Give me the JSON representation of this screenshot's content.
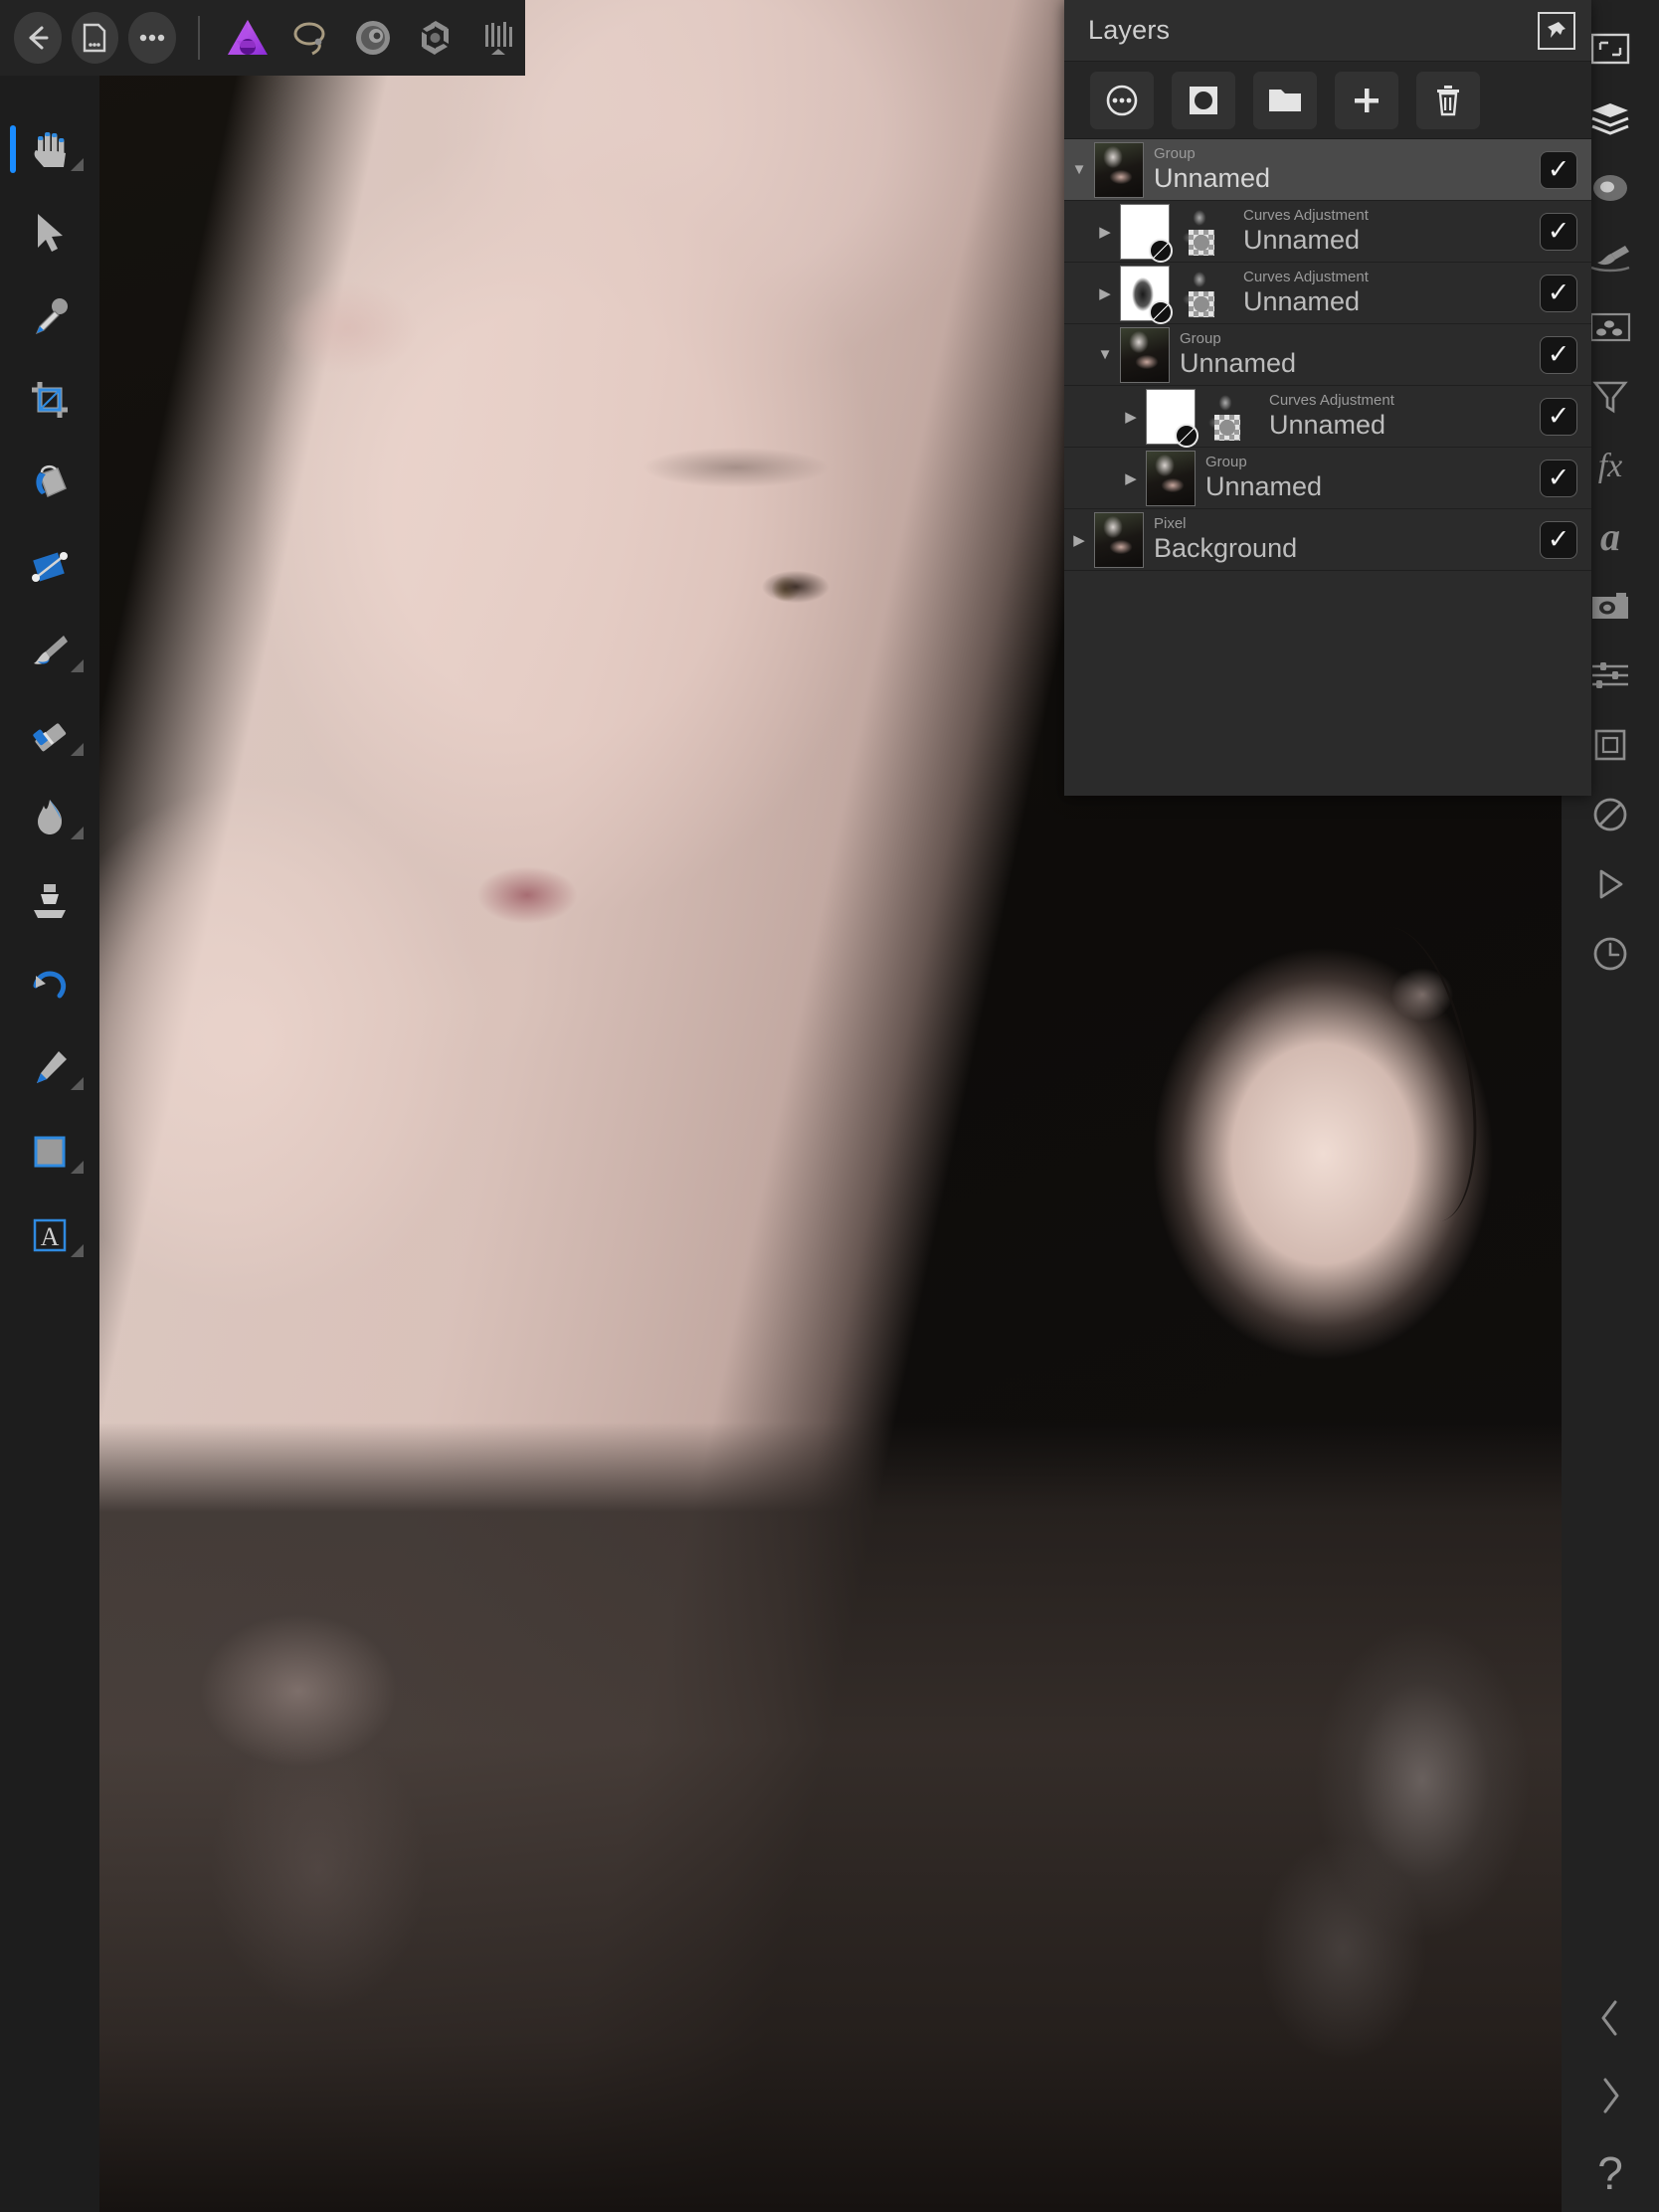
{
  "app": {
    "name": "Affinity Photo",
    "accent": "#1a8cff",
    "brand_purple": "#b44ae0",
    "panel_bg": "#2b2b2b"
  },
  "top_toolbar": {
    "buttons": [
      {
        "name": "back",
        "icon": "back-arrow-icon",
        "label": "←"
      },
      {
        "name": "document",
        "icon": "document-icon",
        "label": "☰"
      },
      {
        "name": "more",
        "icon": "more-ellipsis-icon",
        "label": "•••"
      }
    ],
    "personas": [
      {
        "name": "photo-persona",
        "icon": "affinity-photo-logo-icon"
      },
      {
        "name": "liquify-persona",
        "icon": "liquify-lasso-icon"
      },
      {
        "name": "develop-persona",
        "icon": "develop-spiral-icon"
      },
      {
        "name": "export-persona",
        "icon": "aperture-icon"
      },
      {
        "name": "tone-mapping-persona",
        "icon": "tone-bars-icon"
      }
    ]
  },
  "tools": [
    {
      "name": "hand-tool",
      "icon": "hand-icon",
      "glyph": "✋",
      "active": true,
      "has_flyout": true
    },
    {
      "name": "move-tool",
      "icon": "cursor-arrow-icon",
      "glyph": "➤",
      "active": false,
      "has_flyout": false
    },
    {
      "name": "color-picker-tool",
      "icon": "eyedropper-icon",
      "glyph": "✒",
      "active": false,
      "has_flyout": false
    },
    {
      "name": "crop-tool",
      "icon": "crop-icon",
      "glyph": "⌗",
      "active": false,
      "has_flyout": false
    },
    {
      "name": "paint-bucket-tool",
      "icon": "paint-bucket-icon",
      "glyph": "⛃",
      "active": false,
      "has_flyout": false
    },
    {
      "name": "gradient-tool",
      "icon": "gradient-icon",
      "glyph": "◆",
      "active": false,
      "has_flyout": false
    },
    {
      "name": "paint-brush-tool",
      "icon": "paint-brush-icon",
      "glyph": "✒",
      "active": false,
      "has_flyout": true
    },
    {
      "name": "erase-brush-tool",
      "icon": "eraser-icon",
      "glyph": "✎",
      "active": false,
      "has_flyout": true
    },
    {
      "name": "smudge-brush-tool",
      "icon": "flame-smudge-icon",
      "glyph": "ὒ5",
      "active": false,
      "has_flyout": true
    },
    {
      "name": "clone-brush-tool",
      "icon": "clone-stamp-icon",
      "glyph": "⚒",
      "active": false,
      "has_flyout": false
    },
    {
      "name": "undo-brush-tool",
      "icon": "undo-brush-icon",
      "glyph": "↩",
      "active": false,
      "has_flyout": false
    },
    {
      "name": "pen-tool",
      "icon": "pen-nib-icon",
      "glyph": "✑",
      "active": false,
      "has_flyout": true
    },
    {
      "name": "shape-tool",
      "icon": "rectangle-shape-icon",
      "glyph": "▣",
      "active": false,
      "has_flyout": true
    },
    {
      "name": "text-tool",
      "icon": "text-a-icon",
      "glyph": "A",
      "active": false,
      "has_flyout": true
    }
  ],
  "layers_panel": {
    "title": "Layers",
    "pin": {
      "name": "pin-button",
      "icon": "pushpin-icon"
    },
    "toolbar": [
      {
        "name": "layer-options-button",
        "icon": "more-circle-icon"
      },
      {
        "name": "mask-layer-button",
        "icon": "mask-circle-icon"
      },
      {
        "name": "new-group-button",
        "icon": "folder-icon"
      },
      {
        "name": "add-layer-button",
        "icon": "plus-icon"
      },
      {
        "name": "delete-layer-button",
        "icon": "trash-icon"
      }
    ],
    "rows": [
      {
        "kind": "Group",
        "name": "Unnamed",
        "indent": 0,
        "expanded": true,
        "selected": true,
        "checked": true,
        "thumb": "photo",
        "has_mask": false,
        "has_mini": false
      },
      {
        "kind": "Curves Adjustment",
        "name": "Unnamed",
        "indent": 1,
        "expanded": false,
        "selected": false,
        "checked": true,
        "thumb": "white",
        "has_mask": true,
        "has_mini": true
      },
      {
        "kind": "Curves Adjustment",
        "name": "Unnamed",
        "indent": 1,
        "expanded": false,
        "selected": false,
        "checked": true,
        "thumb": "mask-hand",
        "has_mask": true,
        "has_mini": true
      },
      {
        "kind": "Group",
        "name": "Unnamed",
        "indent": 1,
        "expanded": true,
        "selected": false,
        "checked": true,
        "thumb": "photo",
        "has_mask": false,
        "has_mini": false
      },
      {
        "kind": "Curves Adjustment",
        "name": "Unnamed",
        "indent": 2,
        "expanded": false,
        "selected": false,
        "checked": true,
        "thumb": "white",
        "has_mask": true,
        "has_mini": true
      },
      {
        "kind": "Group",
        "name": "Unnamed",
        "indent": 2,
        "expanded": false,
        "selected": false,
        "checked": true,
        "thumb": "photo",
        "has_mask": false,
        "has_mini": false
      },
      {
        "kind": "Pixel",
        "name": "Background",
        "indent": 0,
        "expanded": false,
        "selected": false,
        "checked": true,
        "thumb": "photo",
        "has_mask": false,
        "has_mini": false
      }
    ],
    "checkmark": "✓",
    "expanded_glyph": "▼",
    "collapsed_glyph": "▶"
  },
  "studio_rail": {
    "icons": [
      {
        "name": "transform-studio",
        "icon": "transform-frame-icon"
      },
      {
        "name": "layers-studio",
        "icon": "layers-stack-icon"
      },
      {
        "name": "adjustment-studio",
        "icon": "adjustment-donut-icon"
      },
      {
        "name": "brushes-studio",
        "icon": "brush-stroke-icon"
      },
      {
        "name": "effects-studio",
        "icon": "live-filter-icon"
      },
      {
        "name": "filters-studio",
        "icon": "funnel-icon"
      },
      {
        "name": "fx-studio",
        "icon": "fx-icon"
      },
      {
        "name": "character-studio",
        "icon": "italic-a-icon"
      },
      {
        "name": "camera-studio",
        "icon": "camera-icon"
      },
      {
        "name": "adjust-sliders-studio",
        "icon": "sliders-icon"
      },
      {
        "name": "swatches-studio",
        "icon": "square-frame-icon"
      },
      {
        "name": "no-selection-studio",
        "icon": "no-entry-icon"
      },
      {
        "name": "macro-studio",
        "icon": "play-triangle-icon"
      },
      {
        "name": "history-studio",
        "icon": "clock-history-icon"
      }
    ],
    "bottom_icons": [
      {
        "name": "previous-panel",
        "icon": "chevron-left-icon"
      },
      {
        "name": "next-panel",
        "icon": "chevron-right-icon"
      },
      {
        "name": "help",
        "icon": "question-mark-icon"
      }
    ]
  }
}
